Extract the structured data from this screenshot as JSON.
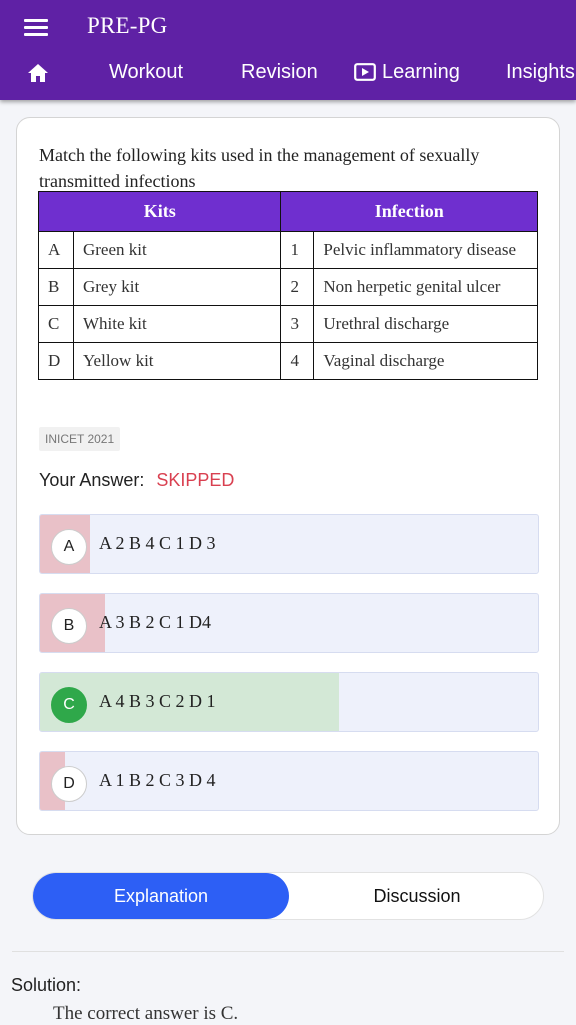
{
  "header": {
    "title": "PRE-PG",
    "nav": [
      {
        "label": "Workout"
      },
      {
        "label": "Revision"
      },
      {
        "label": "Learning"
      },
      {
        "label": "Insights"
      }
    ]
  },
  "question": {
    "text": "Match the following kits used in the management of sexually transmitted infections",
    "table": {
      "headers": [
        "Kits",
        "Infection"
      ],
      "rows": [
        {
          "letter": "A",
          "kit": "Green kit",
          "number": "1",
          "infection": "Pelvic inflammatory disease"
        },
        {
          "letter": "B",
          "kit": "Grey kit",
          "number": "2",
          "infection": "Non herpetic genital ulcer"
        },
        {
          "letter": "C",
          "kit": "White kit",
          "number": "3",
          "infection": "Urethral discharge"
        },
        {
          "letter": "D",
          "kit": "Yellow kit",
          "number": "4",
          "infection": "Vaginal discharge"
        }
      ]
    },
    "tag": "INICET 2021"
  },
  "your_answer": {
    "label": "Your Answer:",
    "status": "SKIPPED"
  },
  "options": [
    {
      "letter": "A",
      "text": "A 2 B 4 C 1 D 3",
      "percent": 10,
      "correct": false
    },
    {
      "letter": "B",
      "text": "A 3 B 2 C 1 D4",
      "percent": 13,
      "correct": false
    },
    {
      "letter": "C",
      "text": "A 4 B 3 C 2 D 1",
      "percent": 60,
      "correct": true
    },
    {
      "letter": "D",
      "text": "A 1 B 2 C 3 D 4",
      "percent": 5,
      "correct": false
    }
  ],
  "colors": {
    "header_bg": "#5f21a5",
    "table_header_bg": "#6f2fcf",
    "wrong_fill": "#e9c1c8",
    "correct_fill": "#d3e8d6",
    "correct_badge": "#2fa84a",
    "active_tab": "#2d5ff5",
    "skipped": "#d94050"
  },
  "tabs": {
    "explanation": "Explanation",
    "discussion": "Discussion"
  },
  "solution": {
    "label": "Solution:",
    "text": "The correct answer is C."
  }
}
